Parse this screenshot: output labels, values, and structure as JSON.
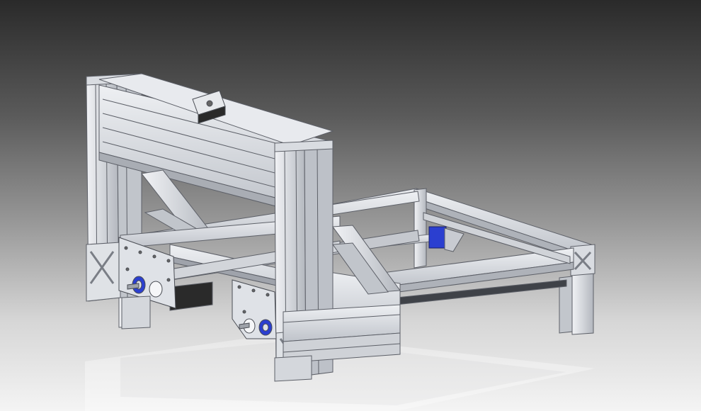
{
  "scene": {
    "subject": "cnc-router-frame-render",
    "colors": {
      "aluminum_light": "#e4e6ea",
      "aluminum_mid": "#c9ccd2",
      "aluminum_shadow": "#a7abb3",
      "edge": "#5d6068",
      "accent_blue": "#2b3fd0",
      "motor_dark": "#2a2a2a",
      "rod": "#bfc3c9"
    }
  }
}
